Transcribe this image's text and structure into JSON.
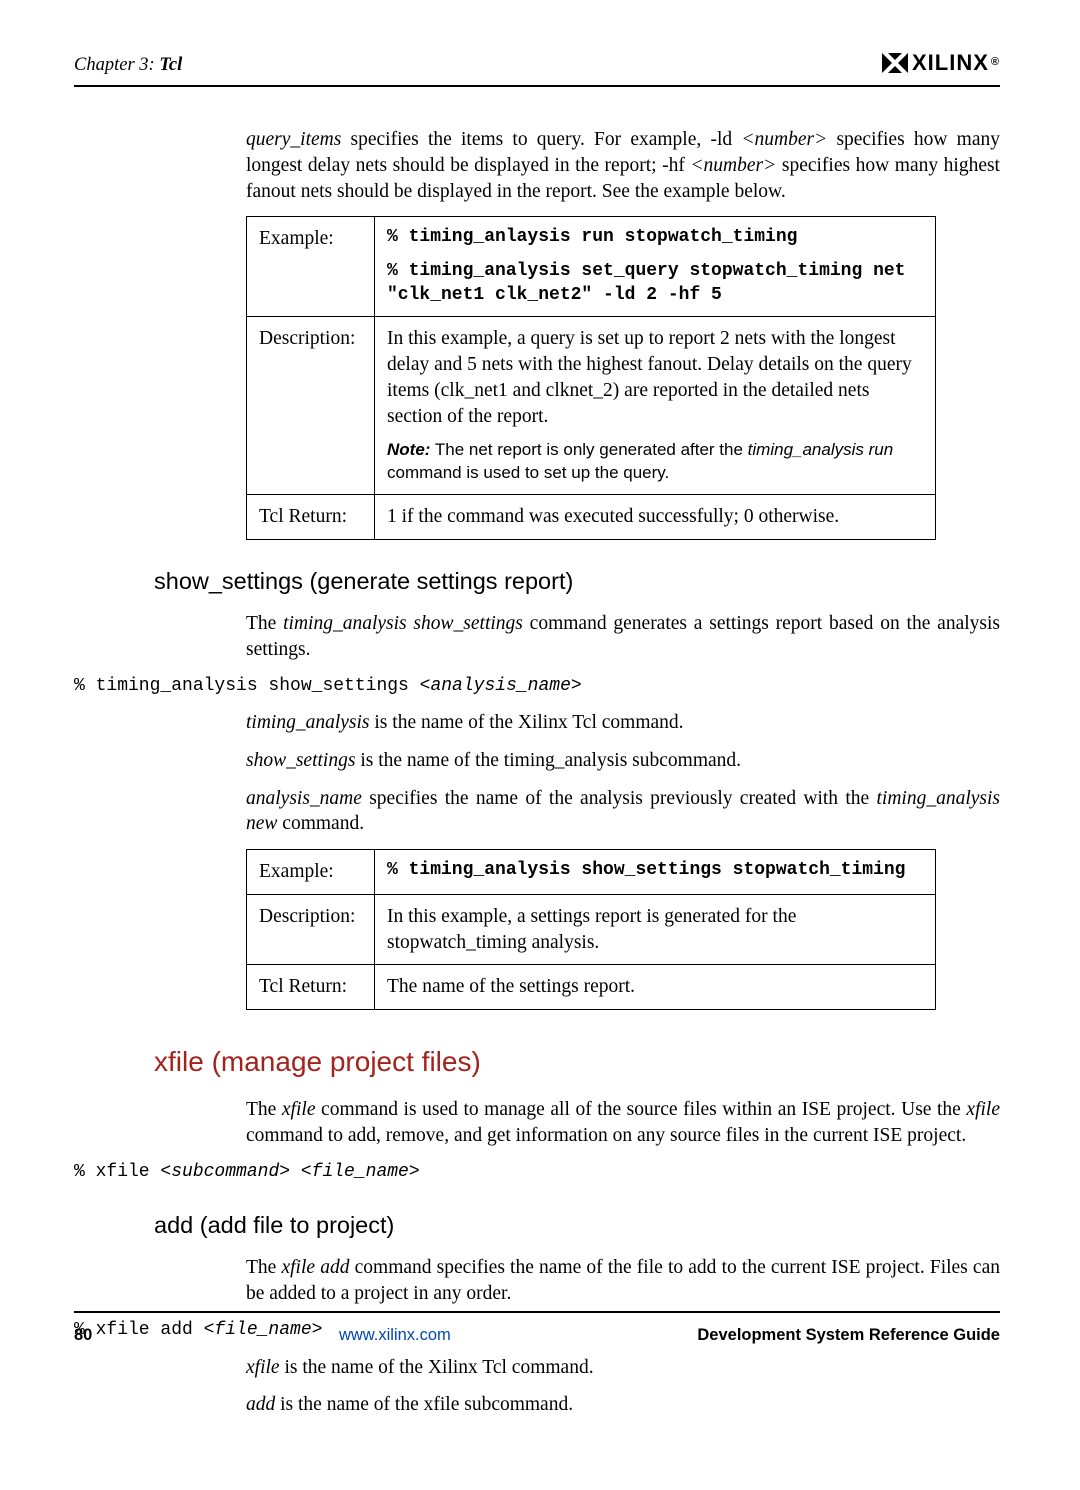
{
  "header": {
    "chapter_pre": "Chapter 3:",
    "chapter_bold": "Tcl",
    "brand": "XILINX",
    "reg": "®"
  },
  "intro_para": {
    "pre_i": "query_items",
    "seg1": " specifies the items to query. For example, -ld ",
    "num_i": "<number>",
    "seg2": " specifies how many longest delay nets should be displayed in the report; -hf ",
    "seg3": " specifies how many highest fanout nets should be displayed in the report. See the example below."
  },
  "table1": {
    "r1k": "Example:",
    "r1c_line1": "% timing_anlaysis run stopwatch_timing",
    "r1c_line2": "% timing_analysis set_query stopwatch_timing net \"clk_net1 clk_net2\" -ld 2 -hf 5",
    "r2k": "Description:",
    "r2c_main": "In this example, a query is set up to report 2 nets with the longest delay and 5 nets with the highest fanout. Delay details on the query items (clk_net1 and clknet_2) are reported in the detailed nets section of the report.",
    "r2c_note_label": "Note:",
    "r2c_note_1": "  The net report is only generated after the ",
    "r2c_note_i": "timing_analysis run",
    "r2c_note_2": " command is used to set up the query.",
    "r3k": "Tcl Return:",
    "r3c": "1 if the command was executed successfully; 0 otherwise."
  },
  "sec1": {
    "h": "show_settings (generate settings report)",
    "p1_pre": "The ",
    "p1_i": "timing_analysis show_settings",
    "p1_post": " command generates a settings report based on the analysis settings.",
    "code1_a": "% timing_analysis show_settings ",
    "code1_b": "<analysis_name>",
    "p2_i": "timing_analysis",
    "p2_post": " is the name of the Xilinx Tcl command.",
    "p3_i": "show_settings",
    "p3_post": " is the name of the timing_analysis subcommand.",
    "p4_i1": "analysis_name",
    "p4_mid": " specifies the name of the analysis previously created with the ",
    "p4_i2": "timing_analysis new",
    "p4_post": " command."
  },
  "table2": {
    "r1k": "Example:",
    "r1c": "% timing_analysis show_settings stopwatch_timing",
    "r2k": "Description:",
    "r2c": "In this example, a settings report is generated for the stopwatch_timing analysis.",
    "r3k": "Tcl Return:",
    "r3c": "The name of the settings report."
  },
  "sec2": {
    "h": "xfile (manage project files)",
    "p1_pre": "The ",
    "p1_i1": "xfile",
    "p1_mid1": " command is used to manage all of the source files within an ISE project. Use the ",
    "p1_i2": "xfile",
    "p1_mid2": " command to add, remove, and get information on any source files in the current ISE project.",
    "code1_a": "% xfile ",
    "code1_b": "<subcommand> <file_name>"
  },
  "sec3": {
    "h": "add (add file to project)",
    "p1_pre": "The ",
    "p1_i": "xfile add",
    "p1_post": " command specifies the name of the file to add to the current ISE project. Files can be added to a project in any order.",
    "code1_a": "% xfile add ",
    "code1_b": "<file_name>",
    "p2_i": "xfile",
    "p2_post": " is the name of the Xilinx Tcl command.",
    "p3_i": "add",
    "p3_post": " is the name of the xfile subcommand."
  },
  "footer": {
    "page": "80",
    "url": "www.xilinx.com",
    "doc": "Development System Reference Guide"
  }
}
